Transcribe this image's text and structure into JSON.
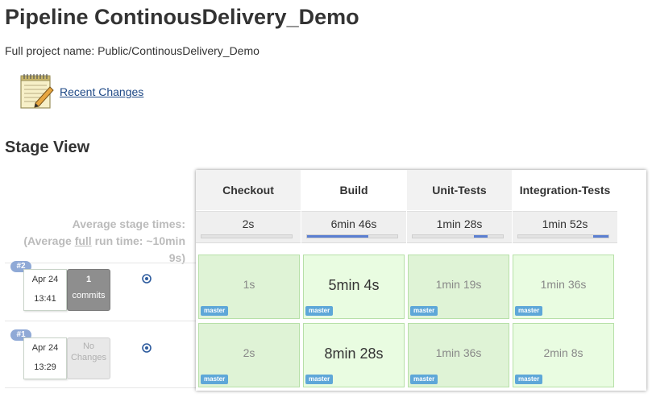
{
  "page": {
    "title": "Pipeline ContinousDelivery_Demo",
    "full_project_label": "Full project name: Public/ContinousDelivery_Demo",
    "recent_changes_label": "Recent Changes",
    "stage_view_heading": "Stage View"
  },
  "avg": {
    "line1": "Average stage times:",
    "line2_pre": "(Average ",
    "line2_link": "full",
    "line2_post": " run time: ~10min",
    "line3": "9s)"
  },
  "stages": [
    {
      "name": "Checkout",
      "avg": "2s",
      "bar_start": 0.0,
      "bar_fraction": 0.0
    },
    {
      "name": "Build",
      "avg": "6min 46s",
      "bar_start": 0.0,
      "bar_fraction": 0.68
    },
    {
      "name": "Unit-Tests",
      "avg": "1min 28s",
      "bar_start": 0.68,
      "bar_fraction": 0.15
    },
    {
      "name": "Integration-Tests",
      "avg": "1min 52s",
      "bar_start": 0.83,
      "bar_fraction": 0.17
    }
  ],
  "runs": [
    {
      "number": "#2",
      "date": "Apr 24",
      "time": "13:41",
      "changes_count": "1",
      "changes_label": "commits",
      "cells": [
        {
          "time": "1s",
          "branch": "master"
        },
        {
          "time": "5min 4s",
          "branch": "master"
        },
        {
          "time": "1min 19s",
          "branch": "master"
        },
        {
          "time": "1min 36s",
          "branch": "master"
        }
      ]
    },
    {
      "number": "#1",
      "date": "Apr 24",
      "time": "13:29",
      "changes_label_1": "No",
      "changes_label_2": "Changes",
      "cells": [
        {
          "time": "2s",
          "branch": "master"
        },
        {
          "time": "8min 28s",
          "branch": "master"
        },
        {
          "time": "1min 36s",
          "branch": "master"
        },
        {
          "time": "2min 8s",
          "branch": "master"
        }
      ]
    }
  ],
  "colors": {
    "success_cell": "#dff3d6",
    "success_cell_light": "#e9fce1",
    "bar_fill": "#5b7fd1",
    "branch_badge": "#5ea7d8",
    "run_tag": "#8fa9d6"
  },
  "icons": {
    "notepad": "notepad-icon",
    "info": "info-circle-icon"
  }
}
